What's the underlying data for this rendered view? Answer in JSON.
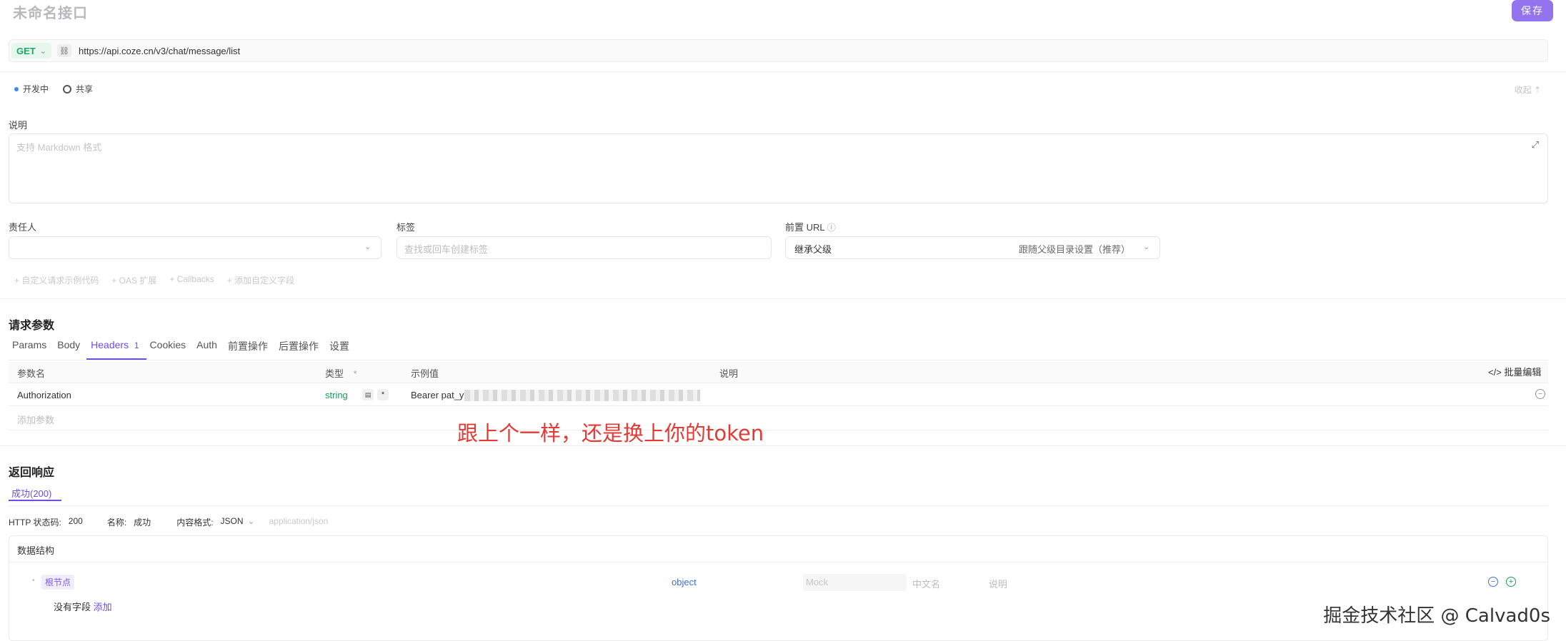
{
  "header": {
    "title": "未命名接口",
    "save_label": "保存"
  },
  "request": {
    "method": "GET",
    "link_icon": "link-icon",
    "url": "https://api.coze.cn/v3/chat/message/list"
  },
  "status": {
    "status_label": "开发中",
    "share_label": "共享",
    "collapse_label": "收起"
  },
  "description": {
    "label": "说明",
    "placeholder": "支持 Markdown 格式"
  },
  "owner": {
    "label": "责任人",
    "value": ""
  },
  "tags": {
    "label": "标签",
    "placeholder": "查找或回车创建标签"
  },
  "prefix_url": {
    "label": "前置 URL",
    "value": "继承父级",
    "hint": "跟随父级目录设置（推荐）"
  },
  "extras": [
    "+ 自定义请求示例代码",
    "+ OAS 扩展",
    "+ Callbacks",
    "+ 添加自定义字段"
  ],
  "params": {
    "title": "请求参数",
    "tabs": [
      {
        "label": "Params"
      },
      {
        "label": "Body"
      },
      {
        "label": "Headers",
        "count": "1",
        "active": true
      },
      {
        "label": "Cookies"
      },
      {
        "label": "Auth"
      },
      {
        "label": "前置操作"
      },
      {
        "label": "后置操作"
      },
      {
        "label": "设置"
      }
    ],
    "columns": {
      "name": "参数名",
      "type": "类型",
      "example": "示例值",
      "desc": "说明",
      "bulk_edit": "批量编辑"
    },
    "rows": [
      {
        "name": "Authorization",
        "type": "string",
        "required": "*",
        "example": "Bearer pat_y"
      }
    ],
    "add_param": "添加参数",
    "annotation": "跟上个一样，还是换上你的token"
  },
  "response": {
    "title": "返回响应",
    "tab": "成功(200)",
    "http_status_label": "HTTP 状态码:",
    "http_status": "200",
    "name_label": "名称:",
    "name": "成功",
    "format_label": "内容格式:",
    "format": "JSON",
    "content_type": "application/json",
    "schema_title": "数据结构",
    "root_node": "根节点",
    "root_type": "object",
    "mock_placeholder": "Mock",
    "cn_name_placeholder": "中文名",
    "desc_placeholder": "说明",
    "no_fields": "没有字段",
    "add": "添加"
  },
  "watermark": "掘金技术社区 @ Calvad0s",
  "colors": {
    "accent": "#6b4fe0",
    "save": "#9373ee",
    "get_green": "#1ea866",
    "annotation_red": "#e53935"
  }
}
